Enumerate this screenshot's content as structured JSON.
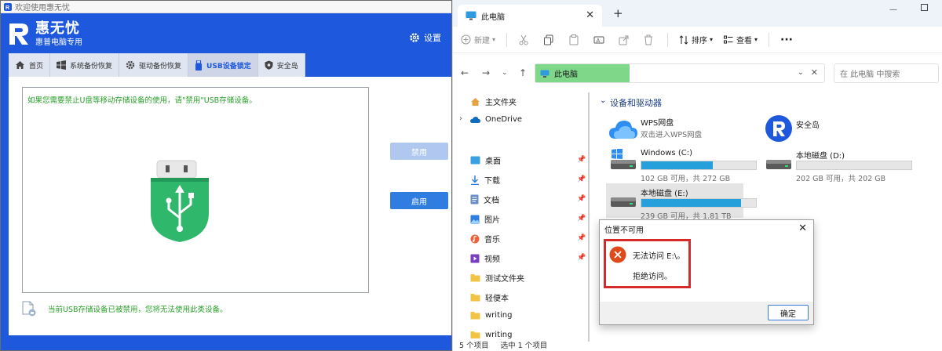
{
  "left_app": {
    "window_title": "欢迎使用惠无忧",
    "brand": "惠无忧",
    "brand_sub": "惠普电脑专用",
    "settings_label": "设置",
    "tabs": [
      {
        "label": "首页",
        "icon": "home-icon"
      },
      {
        "label": "系统备份恢复",
        "icon": "windows-icon"
      },
      {
        "label": "驱动备份恢复",
        "icon": "gear-icon"
      },
      {
        "label": "USB设备锁定",
        "icon": "usb-icon",
        "active": true
      },
      {
        "label": "安全岛",
        "icon": "shield-icon"
      }
    ],
    "warning_text": "如果您需要禁止U盘等移动存储设备的使用，请\"禁用\"USB存储设备。",
    "disable_button": "禁用",
    "enable_button": "启用",
    "status_text": "当前USB存储设备已被禁用，您将无法使用此类设备。",
    "colors": {
      "brand": "#1e58dc",
      "green_text": "#2aa12a",
      "usb_icon": "#2fb86c",
      "enable_button": "#2f7de1",
      "disable_button": "#b0c8ef"
    }
  },
  "explorer": {
    "tab_title": "此电脑",
    "new_tab_symbol": "+",
    "toolbar": {
      "new_label": "新建",
      "sort_label": "排序",
      "view_label": "查看",
      "more_symbol": "···"
    },
    "address": {
      "location": "此电脑"
    },
    "search_placeholder": "在 此电脑 中搜索",
    "nav_items": [
      {
        "label": "主文件夹",
        "icon": "home-icon"
      },
      {
        "label": "OneDrive",
        "icon": "cloud-icon"
      },
      {
        "label": "桌面",
        "icon": "desktop-icon",
        "pinned": true
      },
      {
        "label": "下载",
        "icon": "download-icon",
        "pinned": true
      },
      {
        "label": "文档",
        "icon": "document-icon",
        "pinned": true
      },
      {
        "label": "图片",
        "icon": "picture-icon",
        "pinned": true
      },
      {
        "label": "音乐",
        "icon": "music-icon",
        "pinned": true
      },
      {
        "label": "视频",
        "icon": "video-icon",
        "pinned": true
      },
      {
        "label": "测试文件夹",
        "icon": "folder-icon"
      },
      {
        "label": "轻便本",
        "icon": "folder-icon"
      },
      {
        "label": "writing",
        "icon": "folder-icon"
      },
      {
        "label": "writing",
        "icon": "folder-icon"
      }
    ],
    "section_title": "设备和驱动器",
    "drives": [
      {
        "name": "WPS网盘",
        "sub": "双击进入WPS网盘",
        "icon": "cloud-drive-icon"
      },
      {
        "name": "安全岛",
        "icon": "app-logo-icon"
      },
      {
        "name": "Windows (C:)",
        "size": "102 GB 可用，共 272 GB",
        "used_fraction": 0.62,
        "icon": "windows-drive-icon"
      },
      {
        "name": "本地磁盘 (D:)",
        "size": "202 GB 可用，共 202 GB",
        "used_fraction": 0.0,
        "icon": "drive-icon"
      },
      {
        "name": "本地磁盘 (E:)",
        "size": "239 GB 可用，共 1.81 TB",
        "used_fraction": 0.87,
        "icon": "drive-icon"
      }
    ],
    "status": {
      "count": "5 个项目",
      "selected": "选中 1 个项目"
    },
    "colors": {
      "address_highlight": "#7fd88a",
      "drive_bar": "#26a0da",
      "section_title": "#1d3f86"
    }
  },
  "dialog": {
    "title": "位置不可用",
    "line1": "无法访问 E:\\。",
    "line2": "拒绝访问。",
    "ok_label": "确定",
    "colors": {
      "error_icon": "#e04a1a",
      "highlight_box": "#d62a2a"
    }
  }
}
